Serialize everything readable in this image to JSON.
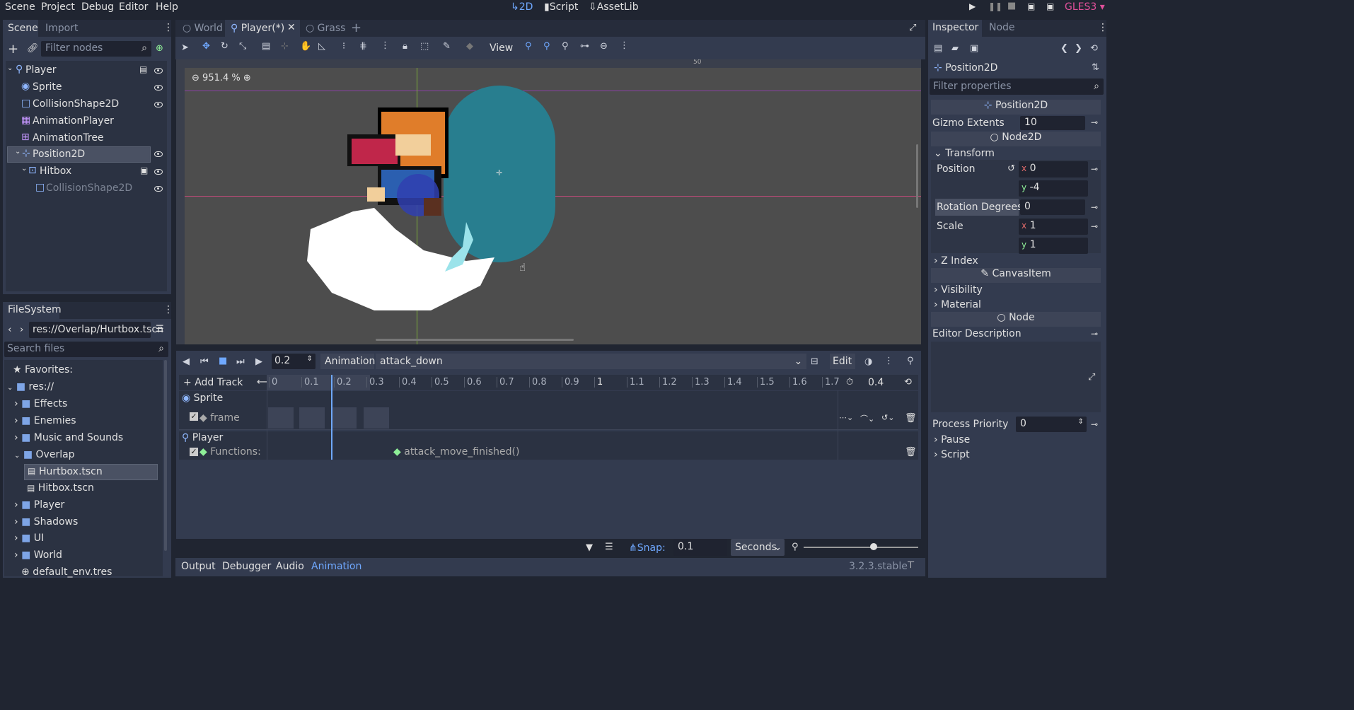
{
  "menu": [
    "Scene",
    "Project",
    "Debug",
    "Editor",
    "Help"
  ],
  "workspaces": {
    "2d": "2D",
    "script": "Script",
    "assetlib": "AssetLib"
  },
  "renderer": "GLES3",
  "scene_tabs": [
    "Scene",
    "Import"
  ],
  "filter_nodes_placeholder": "Filter nodes",
  "tree": [
    {
      "label": "Player"
    },
    {
      "label": "Sprite"
    },
    {
      "label": "CollisionShape2D"
    },
    {
      "label": "AnimationPlayer"
    },
    {
      "label": "AnimationTree"
    },
    {
      "label": "Position2D"
    },
    {
      "label": "Hitbox"
    },
    {
      "label": "CollisionShape2D"
    }
  ],
  "editor_tabs": [
    "World",
    "Player(*)",
    "Grass"
  ],
  "toolbar": {
    "view": "View"
  },
  "zoom": "951.4 %",
  "ruler_label": "50",
  "filesystem": {
    "title": "FileSystem",
    "path": "res://Overlap/Hurtbox.tscn",
    "search_placeholder": "Search files",
    "items": [
      "Favorites:",
      "res://",
      "Effects",
      "Enemies",
      "Music and Sounds",
      "Overlap",
      "Hurtbox.tscn",
      "Hitbox.tscn",
      "Player",
      "Shadows",
      "UI",
      "World",
      "default_env.tres"
    ]
  },
  "anim": {
    "time": "0.2",
    "animation_label": "Animation",
    "animation_name": "attack_down",
    "edit": "Edit",
    "add_track": "Add Track",
    "length": "0.4",
    "ticks": [
      "0",
      "0.1",
      "0.2",
      "0.3",
      "0.4",
      "0.5",
      "0.6",
      "0.7",
      "0.8",
      "0.9",
      "1",
      "1.1",
      "1.2",
      "1.3",
      "1.4",
      "1.5",
      "1.6",
      "1.7"
    ],
    "sprite_node": "Sprite",
    "track_frame": "frame",
    "player_node": "Player",
    "track_functions": "Functions:",
    "call": "attack_move_finished()",
    "snap_label": "Snap:",
    "snap_value": "0.1",
    "snap_unit": "Seconds"
  },
  "bottom_tabs": [
    "Output",
    "Debugger",
    "Audio",
    "Animation"
  ],
  "version": "3.2.3.stable",
  "inspector": {
    "tabs": [
      "Inspector",
      "Node"
    ],
    "object": "Position2D",
    "filter_placeholder": "Filter properties",
    "section_position2d": "Position2D",
    "gizmo_label": "Gizmo Extents",
    "gizmo_value": "10",
    "section_node2d": "Node2D",
    "transform": "Transform",
    "position_label": "Position",
    "pos_x": "0",
    "pos_y": "-4",
    "rotation_label": "Rotation Degrees",
    "rotation_value": "0",
    "scale_label": "Scale",
    "scale_x": "1",
    "scale_y": "1",
    "z_index": "Z Index",
    "section_canvasitem": "CanvasItem",
    "visibility": "Visibility",
    "material": "Material",
    "section_node": "Node",
    "editor_description": "Editor Description",
    "process_priority": "Process Priority",
    "process_value": "0",
    "pause": "Pause",
    "script": "Script",
    "axis_x": "x",
    "axis_y": "y"
  }
}
